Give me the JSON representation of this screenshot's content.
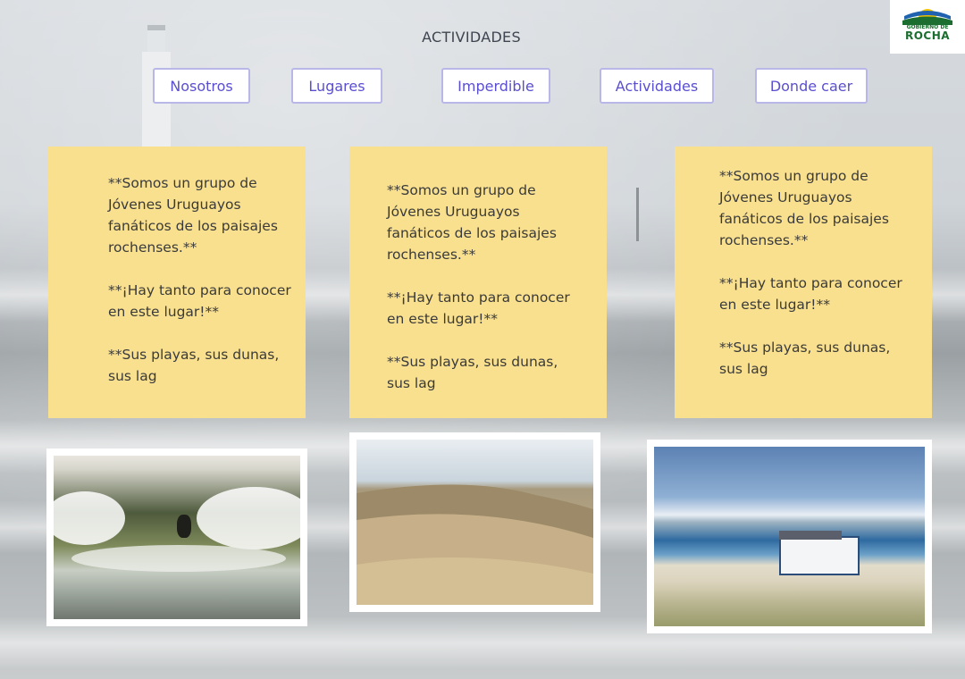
{
  "header": {
    "title": "ACTIVIDADES"
  },
  "logo": {
    "line1": "GOBIERNO DE",
    "line2": "ROCHA",
    "colors": {
      "green": "#1b6e2f",
      "yellow": "#f2c200",
      "blue": "#1f63b0"
    }
  },
  "nav": {
    "items": [
      {
        "label": "Nosotros"
      },
      {
        "label": "Lugares"
      },
      {
        "label": "Imperdible"
      },
      {
        "label": "Actividades"
      },
      {
        "label": "Donde caer"
      }
    ]
  },
  "cards": [
    {
      "p1": "**Somos un grupo de Jóvenes Uruguayos fanáticos de los paisajes rochenses.**",
      "p2": "**¡Hay tanto para conocer en este lugar!**",
      "p3": "**Sus playas, sus dunas, sus lag"
    },
    {
      "p1": "**Somos un grupo de Jóvenes Uruguayos fanáticos de los paisajes rochenses.**",
      "p2": "**¡Hay tanto para conocer en este lugar!**",
      "p3": "**Sus playas, sus dunas, sus lag"
    },
    {
      "p1": "**Somos un grupo de Jóvenes Uruguayos fanáticos de los paisajes rochenses.**",
      "p2": "**¡Hay tanto para conocer en este lugar!**",
      "p3": "**Sus playas, sus dunas, sus lag"
    }
  ],
  "photos": [
    {
      "subject": "surfer-in-wave"
    },
    {
      "subject": "sand-dunes"
    },
    {
      "subject": "beach-truck"
    }
  ],
  "theme": {
    "card_bg": "#f9e08f",
    "nav_text": "#5a4fd0",
    "nav_border": "#b9b6e8"
  }
}
